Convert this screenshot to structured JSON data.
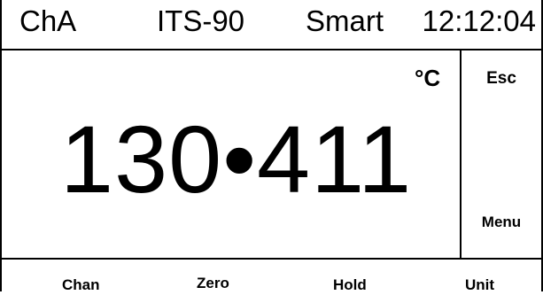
{
  "status_bar": {
    "channel": "ChA",
    "scale": "ITS-90",
    "mode": "Smart",
    "time": "12:12:04"
  },
  "display": {
    "unit": "°C",
    "reading": "130•411"
  },
  "side_buttons": {
    "esc": "Esc",
    "menu": "Menu"
  },
  "softkeys": {
    "chan": "Chan",
    "zero": "Zero",
    "hold": "Hold",
    "unit": "Unit"
  }
}
